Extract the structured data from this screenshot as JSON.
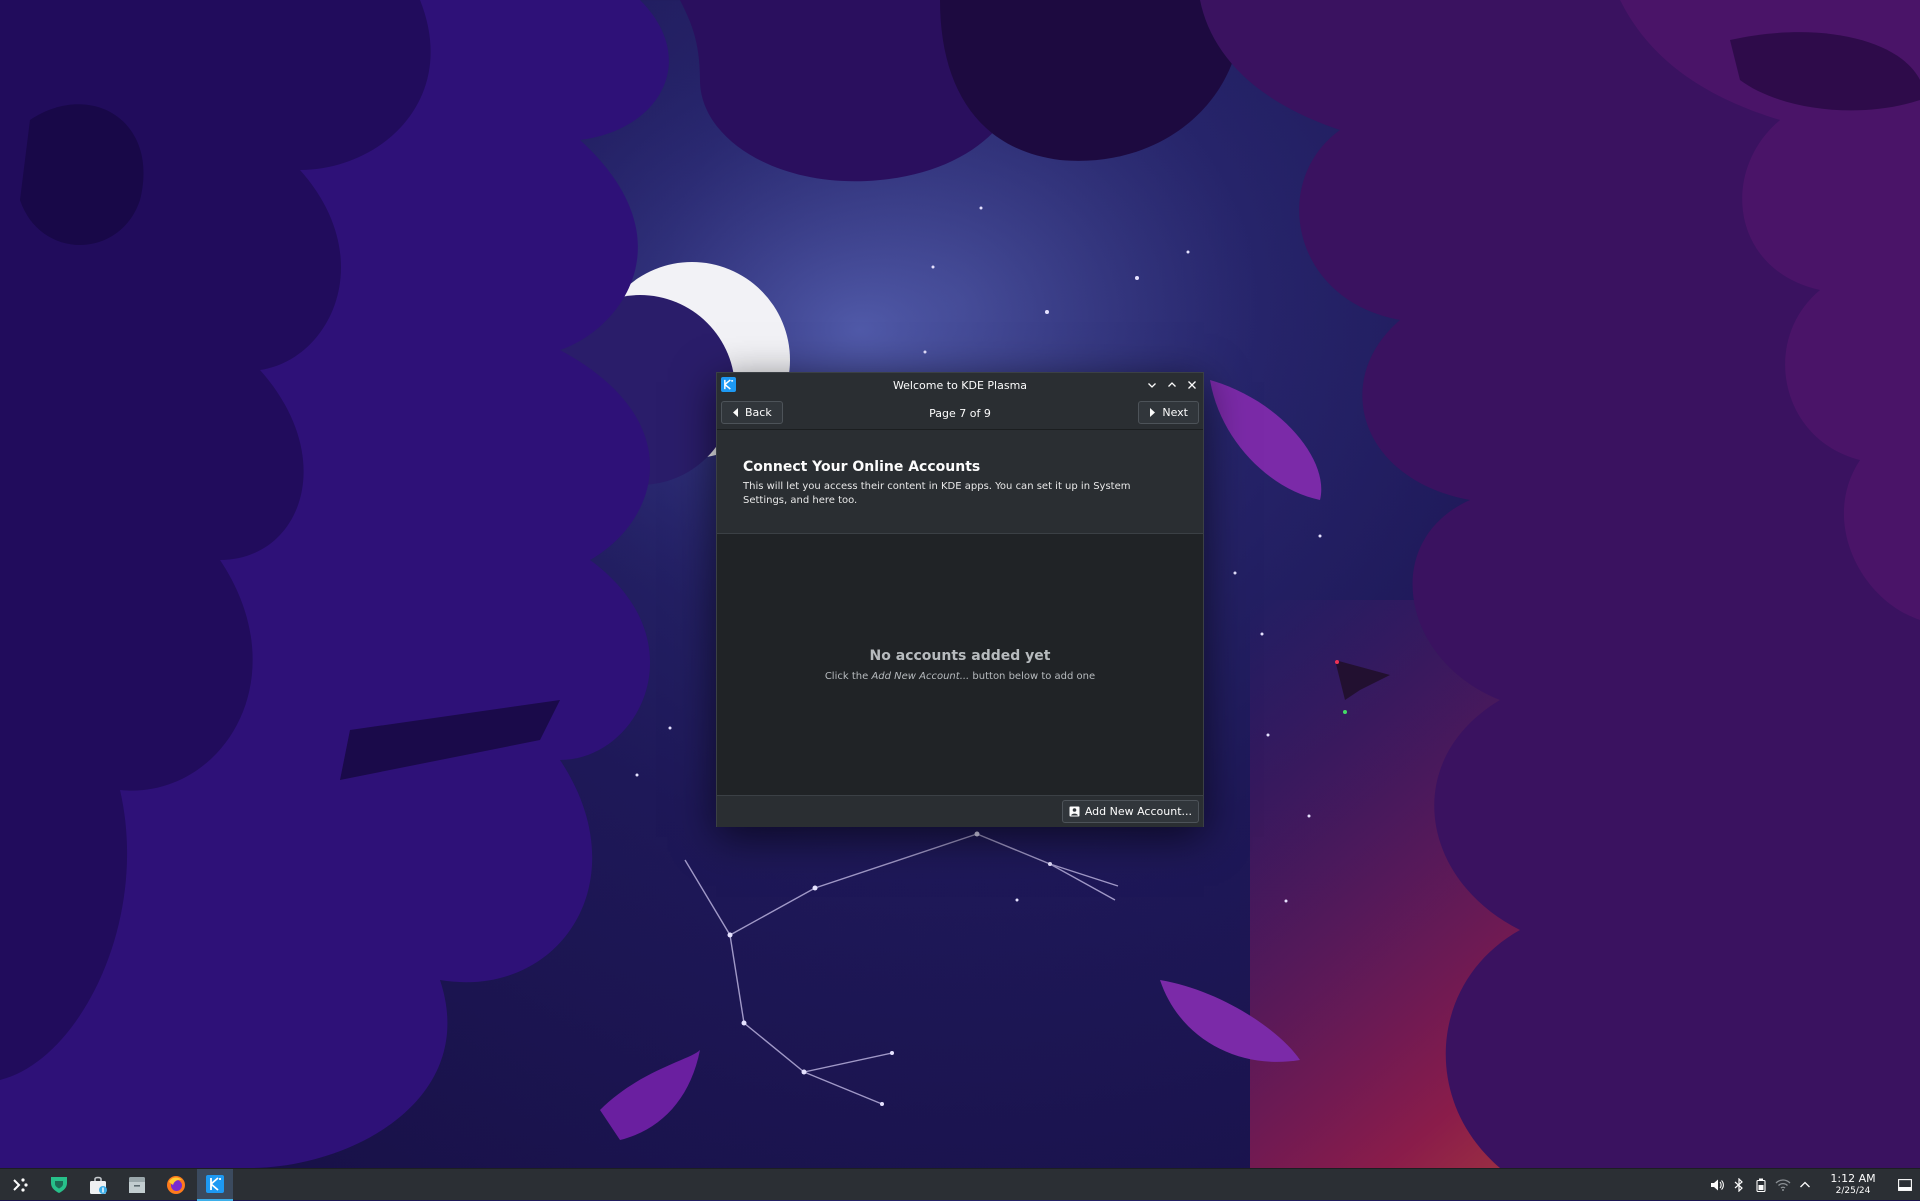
{
  "window": {
    "title": "Welcome to KDE Plasma",
    "back_label": "Back",
    "next_label": "Next",
    "page_indicator": "Page 7 of 9",
    "heading": "Connect Your Online Accounts",
    "description": "This will let you access their content in KDE apps. You can set it up in System Settings, and here too.",
    "empty_title": "No accounts added yet",
    "empty_hint_before": "Click the ",
    "empty_hint_emphasis": "Add New Account...",
    "empty_hint_after": " button below to add one",
    "add_button_label": "Add New Account..."
  },
  "taskbar": {
    "items": [
      {
        "name": "application-launcher-icon"
      },
      {
        "name": "discover-icon"
      },
      {
        "name": "shopping-bag-icon"
      },
      {
        "name": "file-manager-icon"
      },
      {
        "name": "firefox-icon"
      },
      {
        "name": "kde-welcome-icon",
        "active": true
      }
    ],
    "tray": [
      "volume-icon",
      "bluetooth-icon",
      "battery-icon",
      "network-icon",
      "chevron-up-icon"
    ],
    "clock_time": "1:12 AM",
    "clock_date": "2/25/24"
  },
  "colors": {
    "accent": "#3daee9",
    "window_bg": "#202326",
    "header_bg": "#2a2e32",
    "panel_bg": "#2b2f34"
  }
}
